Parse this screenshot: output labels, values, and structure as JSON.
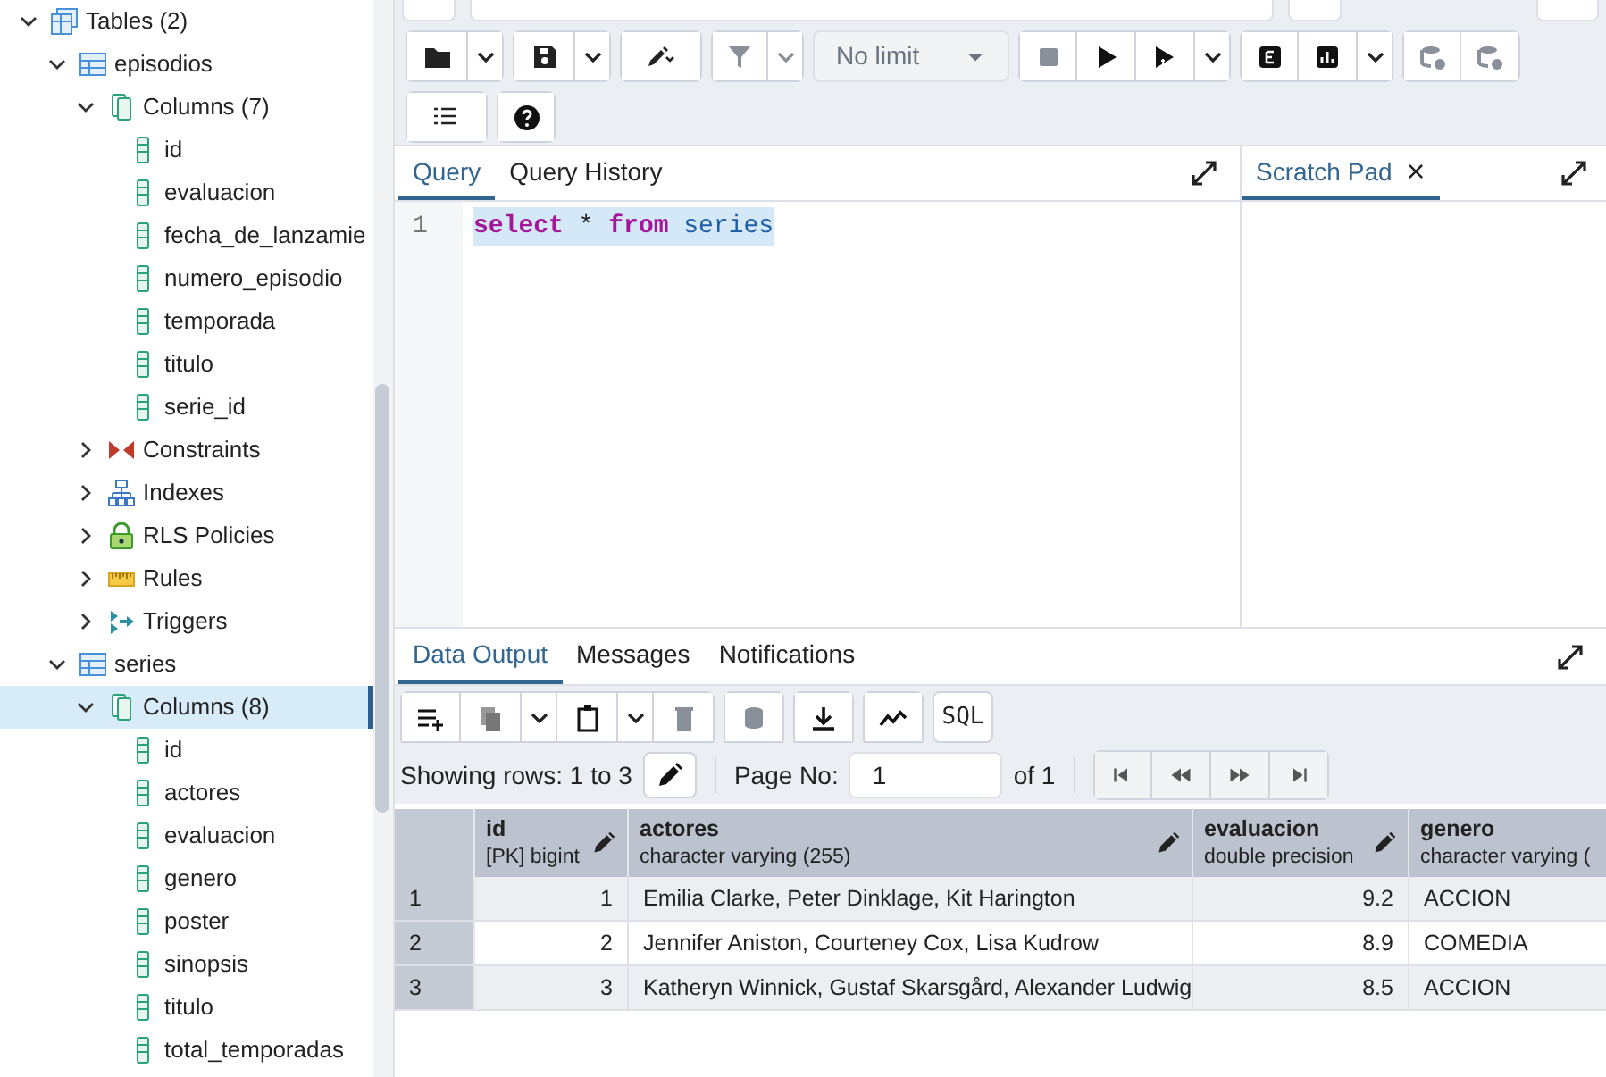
{
  "tree": [
    {
      "kind": "tables",
      "label": "Tables (2)",
      "expanded": true,
      "selected": false,
      "children": [
        {
          "kind": "table",
          "label": "episodios",
          "expanded": true,
          "selected": false,
          "children": [
            {
              "kind": "columns",
              "label": "Columns (7)",
              "expanded": true,
              "selected": false,
              "children": [
                {
                  "kind": "column",
                  "label": "id",
                  "selected": false
                },
                {
                  "kind": "column",
                  "label": "evaluacion",
                  "selected": false
                },
                {
                  "kind": "column",
                  "label": "fecha_de_lanzamie",
                  "selected": false
                },
                {
                  "kind": "column",
                  "label": "numero_episodio",
                  "selected": false
                },
                {
                  "kind": "column",
                  "label": "temporada",
                  "selected": false
                },
                {
                  "kind": "column",
                  "label": "titulo",
                  "selected": false
                },
                {
                  "kind": "column",
                  "label": "serie_id",
                  "selected": false
                }
              ]
            },
            {
              "kind": "constraints",
              "label": "Constraints",
              "expanded": false,
              "selected": false
            },
            {
              "kind": "indexes",
              "label": "Indexes",
              "expanded": false,
              "selected": false
            },
            {
              "kind": "rls",
              "label": "RLS Policies",
              "expanded": false,
              "selected": false
            },
            {
              "kind": "rules",
              "label": "Rules",
              "expanded": false,
              "selected": false
            },
            {
              "kind": "triggers",
              "label": "Triggers",
              "expanded": false,
              "selected": false
            }
          ]
        },
        {
          "kind": "table",
          "label": "series",
          "expanded": true,
          "selected": false,
          "children": [
            {
              "kind": "columns",
              "label": "Columns (8)",
              "expanded": true,
              "selected": true,
              "children": [
                {
                  "kind": "column",
                  "label": "id",
                  "selected": false
                },
                {
                  "kind": "column",
                  "label": "actores",
                  "selected": false
                },
                {
                  "kind": "column",
                  "label": "evaluacion",
                  "selected": false
                },
                {
                  "kind": "column",
                  "label": "genero",
                  "selected": false
                },
                {
                  "kind": "column",
                  "label": "poster",
                  "selected": false
                },
                {
                  "kind": "column",
                  "label": "sinopsis",
                  "selected": false
                },
                {
                  "kind": "column",
                  "label": "titulo",
                  "selected": false
                },
                {
                  "kind": "column",
                  "label": "total_temporadas",
                  "selected": false
                }
              ]
            }
          ]
        }
      ]
    }
  ],
  "toolbar": {
    "limit": "No limit"
  },
  "query_tabs": [
    {
      "label": "Query",
      "selected": true
    },
    {
      "label": "Query History",
      "selected": false
    }
  ],
  "scratch_pad": {
    "label": "Scratch Pad",
    "close": "×"
  },
  "editor": {
    "lines": [
      {
        "number": "1",
        "selected": true,
        "tokens": [
          {
            "kind": "keyword",
            "text": "select"
          },
          {
            "kind": "plain",
            "text": " * "
          },
          {
            "kind": "keyword",
            "text": "from"
          },
          {
            "kind": "identifier",
            "text": " series"
          }
        ]
      }
    ]
  },
  "output_tabs": [
    {
      "label": "Data Output",
      "selected": true
    },
    {
      "label": "Messages",
      "selected": false
    },
    {
      "label": "Notifications",
      "selected": false
    }
  ],
  "output_toolbar": {
    "sql_button": "SQL"
  },
  "paging": {
    "showing": "Showing rows: 1 to 3",
    "page_label": "Page No:",
    "page": "1",
    "of": "of 1"
  },
  "table": {
    "columns": [
      {
        "name": "id",
        "type": "[PK] bigint",
        "kind": "number"
      },
      {
        "name": "actores",
        "type": "character varying (255)",
        "kind": "text"
      },
      {
        "name": "evaluacion",
        "type": "double precision",
        "kind": "number"
      },
      {
        "name": "genero",
        "type": "character varying (",
        "kind": "text"
      }
    ],
    "rows": [
      {
        "number": "1",
        "cells": [
          "1",
          "Emilia Clarke, Peter Dinklage, Kit Harington",
          "9.2",
          "ACCION"
        ]
      },
      {
        "number": "2",
        "cells": [
          "2",
          "Jennifer Aniston, Courteney Cox, Lisa Kudrow",
          "8.9",
          "COMEDIA"
        ]
      },
      {
        "number": "3",
        "cells": [
          "3",
          "Katheryn Winnick, Gustaf Skarsgård, Alexander Ludwig",
          "8.5",
          "ACCION"
        ]
      }
    ]
  }
}
